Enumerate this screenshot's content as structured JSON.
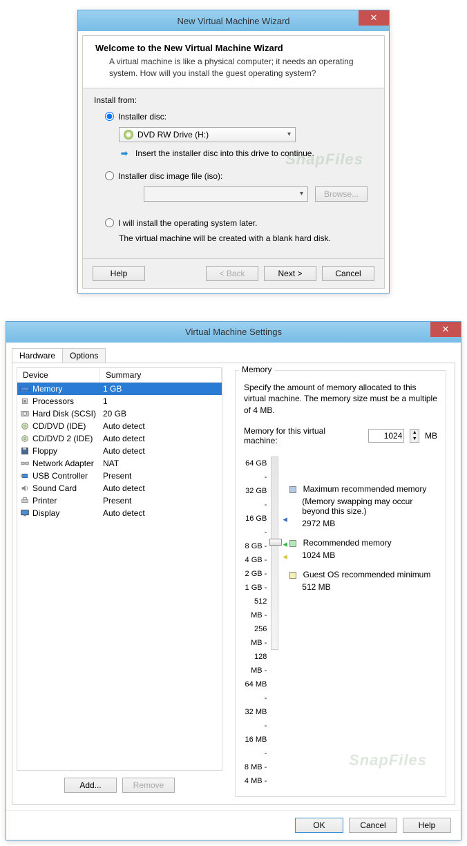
{
  "wizard": {
    "title": "New Virtual Machine Wizard",
    "heading": "Welcome to the New Virtual Machine Wizard",
    "sub": "A virtual machine is like a physical computer; it needs an operating system. How will you install the guest operating system?",
    "install_from": "Install from:",
    "opt_disc": "Installer disc:",
    "drive_selected": "DVD RW Drive (H:)",
    "hint": "Insert the installer disc into this drive to continue.",
    "opt_iso": "Installer disc image file (iso):",
    "browse": "Browse...",
    "opt_later": "I will install the operating system later.",
    "later_note": "The virtual machine will be created with a blank hard disk.",
    "help": "Help",
    "back": "< Back",
    "next": "Next >",
    "cancel": "Cancel"
  },
  "settings": {
    "title": "Virtual Machine Settings",
    "tab_hardware": "Hardware",
    "tab_options": "Options",
    "col_device": "Device",
    "col_summary": "Summary",
    "devices": [
      {
        "name": "Memory",
        "summary": "1 GB",
        "selected": true,
        "icon": "mem"
      },
      {
        "name": "Processors",
        "summary": "1",
        "icon": "cpu"
      },
      {
        "name": "Hard Disk (SCSI)",
        "summary": "20 GB",
        "icon": "hdd"
      },
      {
        "name": "CD/DVD (IDE)",
        "summary": "Auto detect",
        "icon": "cd"
      },
      {
        "name": "CD/DVD 2 (IDE)",
        "summary": "Auto detect",
        "icon": "cd"
      },
      {
        "name": "Floppy",
        "summary": "Auto detect",
        "icon": "floppy"
      },
      {
        "name": "Network Adapter",
        "summary": "NAT",
        "icon": "net"
      },
      {
        "name": "USB Controller",
        "summary": "Present",
        "icon": "usb"
      },
      {
        "name": "Sound Card",
        "summary": "Auto detect",
        "icon": "snd"
      },
      {
        "name": "Printer",
        "summary": "Present",
        "icon": "prn"
      },
      {
        "name": "Display",
        "summary": "Auto detect",
        "icon": "disp"
      }
    ],
    "add": "Add...",
    "remove": "Remove",
    "mem_label": "Memory",
    "mem_desc": "Specify the amount of memory allocated to this virtual machine. The memory size must be a multiple of 4 MB.",
    "mem_field_label": "Memory for this virtual machine:",
    "mem_value": "1024",
    "mem_unit": "MB",
    "ticks": [
      "64 GB",
      "32 GB",
      "16 GB",
      "8 GB",
      "4 GB",
      "2 GB",
      "1 GB",
      "512 MB",
      "256 MB",
      "128 MB",
      "64 MB",
      "32 MB",
      "16 MB",
      "8 MB",
      "4 MB"
    ],
    "legend_max": "Maximum recommended memory",
    "legend_max_note": "(Memory swapping may occur beyond this size.)",
    "legend_max_val": "2972 MB",
    "legend_rec": "Recommended memory",
    "legend_rec_val": "1024 MB",
    "legend_min": "Guest OS recommended minimum",
    "legend_min_val": "512 MB",
    "ok": "OK",
    "cancel": "Cancel",
    "help": "Help"
  },
  "watermark": "SnapFiles"
}
